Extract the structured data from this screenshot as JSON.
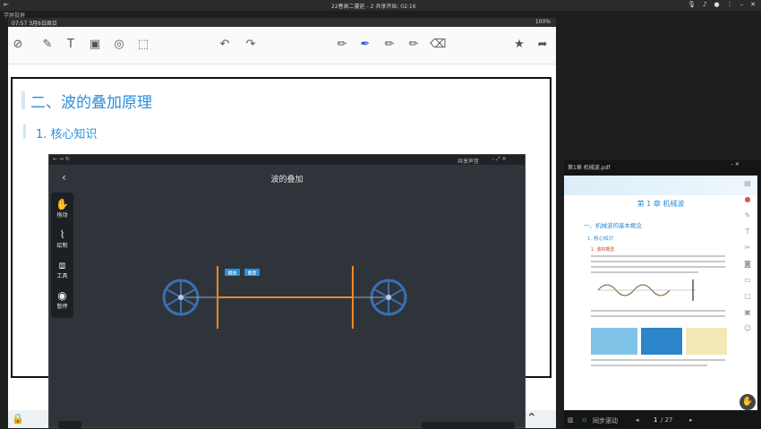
{
  "meeting": {
    "title": "22春高二蔓延 - 2   共享开始: 02:16",
    "sub_label": "学屏投屏"
  },
  "tablet": {
    "status_time": "07:57  3月6日周日",
    "status_battery": "100%"
  },
  "document": {
    "heading1": "二、波的叠加原理",
    "heading2": "1. 核心知识"
  },
  "simulation": {
    "title": "波的叠加",
    "share_audio": "共享声音",
    "tools": [
      {
        "label": "拖动",
        "icon": "hand-icon"
      },
      {
        "label": "绘制",
        "icon": "draw-icon"
      },
      {
        "label": "工具",
        "icon": "toolbox-icon"
      },
      {
        "label": "暂停",
        "icon": "pause-icon"
      }
    ],
    "buttons": [
      "播放",
      "重置"
    ],
    "accent_color": "#f08a24",
    "wheel_color": "#3a6fb4"
  },
  "pdf": {
    "window_title": "第1章 机械波.pdf",
    "chapter_title": "第 1 章 机械波",
    "section1": "一、机械波的基本概念",
    "section2": "1. 核心知识",
    "section3": "1. 波的概念",
    "page_label": "同步滚动",
    "page_current": "1",
    "page_total": "/ 27"
  }
}
